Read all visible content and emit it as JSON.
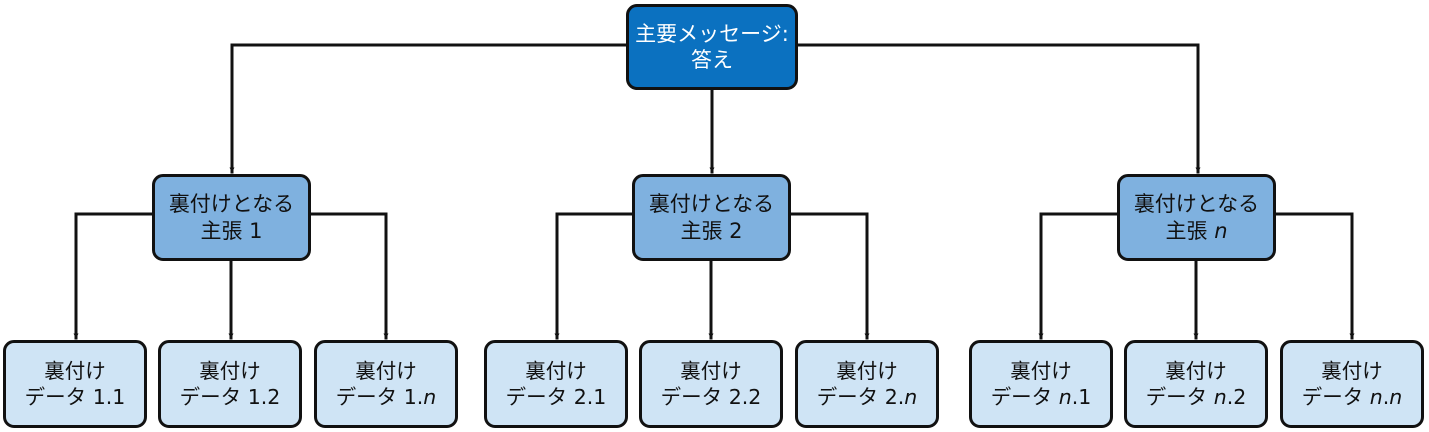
{
  "main_message": {
    "line1": "主要メッセージ:",
    "line2": "答え"
  },
  "claims": [
    {
      "line1": "裏付けとなる",
      "prefix": "主張 ",
      "id": "1",
      "id_italic": false
    },
    {
      "line1": "裏付けとなる",
      "prefix": "主張 ",
      "id": "2",
      "id_italic": false
    },
    {
      "line1": "裏付けとなる",
      "prefix": "主張 ",
      "id": "n",
      "id_italic": true
    }
  ],
  "data": [
    {
      "line1": "裏付け",
      "prefix": "データ ",
      "p1": "1",
      "p1_italic": false,
      "sep": ".",
      "p2": "1",
      "p2_italic": false
    },
    {
      "line1": "裏付け",
      "prefix": "データ ",
      "p1": "1",
      "p1_italic": false,
      "sep": ".",
      "p2": "2",
      "p2_italic": false
    },
    {
      "line1": "裏付け",
      "prefix": "データ ",
      "p1": "1",
      "p1_italic": false,
      "sep": ".",
      "p2": "n",
      "p2_italic": true
    },
    {
      "line1": "裏付け",
      "prefix": "データ ",
      "p1": "2",
      "p1_italic": false,
      "sep": ".",
      "p2": "1",
      "p2_italic": false
    },
    {
      "line1": "裏付け",
      "prefix": "データ ",
      "p1": "2",
      "p1_italic": false,
      "sep": ".",
      "p2": "2",
      "p2_italic": false
    },
    {
      "line1": "裏付け",
      "prefix": "データ ",
      "p1": "2",
      "p1_italic": false,
      "sep": ".",
      "p2": "n",
      "p2_italic": true
    },
    {
      "line1": "裏付け",
      "prefix": "データ ",
      "p1": "n",
      "p1_italic": true,
      "sep": ".",
      "p2": "1",
      "p2_italic": false
    },
    {
      "line1": "裏付け",
      "prefix": "データ ",
      "p1": "n",
      "p1_italic": true,
      "sep": ".",
      "p2": "2",
      "p2_italic": false
    },
    {
      "line1": "裏付け",
      "prefix": "データ ",
      "p1": "n",
      "p1_italic": true,
      "sep": ".",
      "p2": "n",
      "p2_italic": true
    }
  ],
  "colors": {
    "main_fill": "#0b71c0",
    "claim_fill": "#7fb1df",
    "data_fill": "#cfe4f5",
    "stroke": "#111111"
  }
}
